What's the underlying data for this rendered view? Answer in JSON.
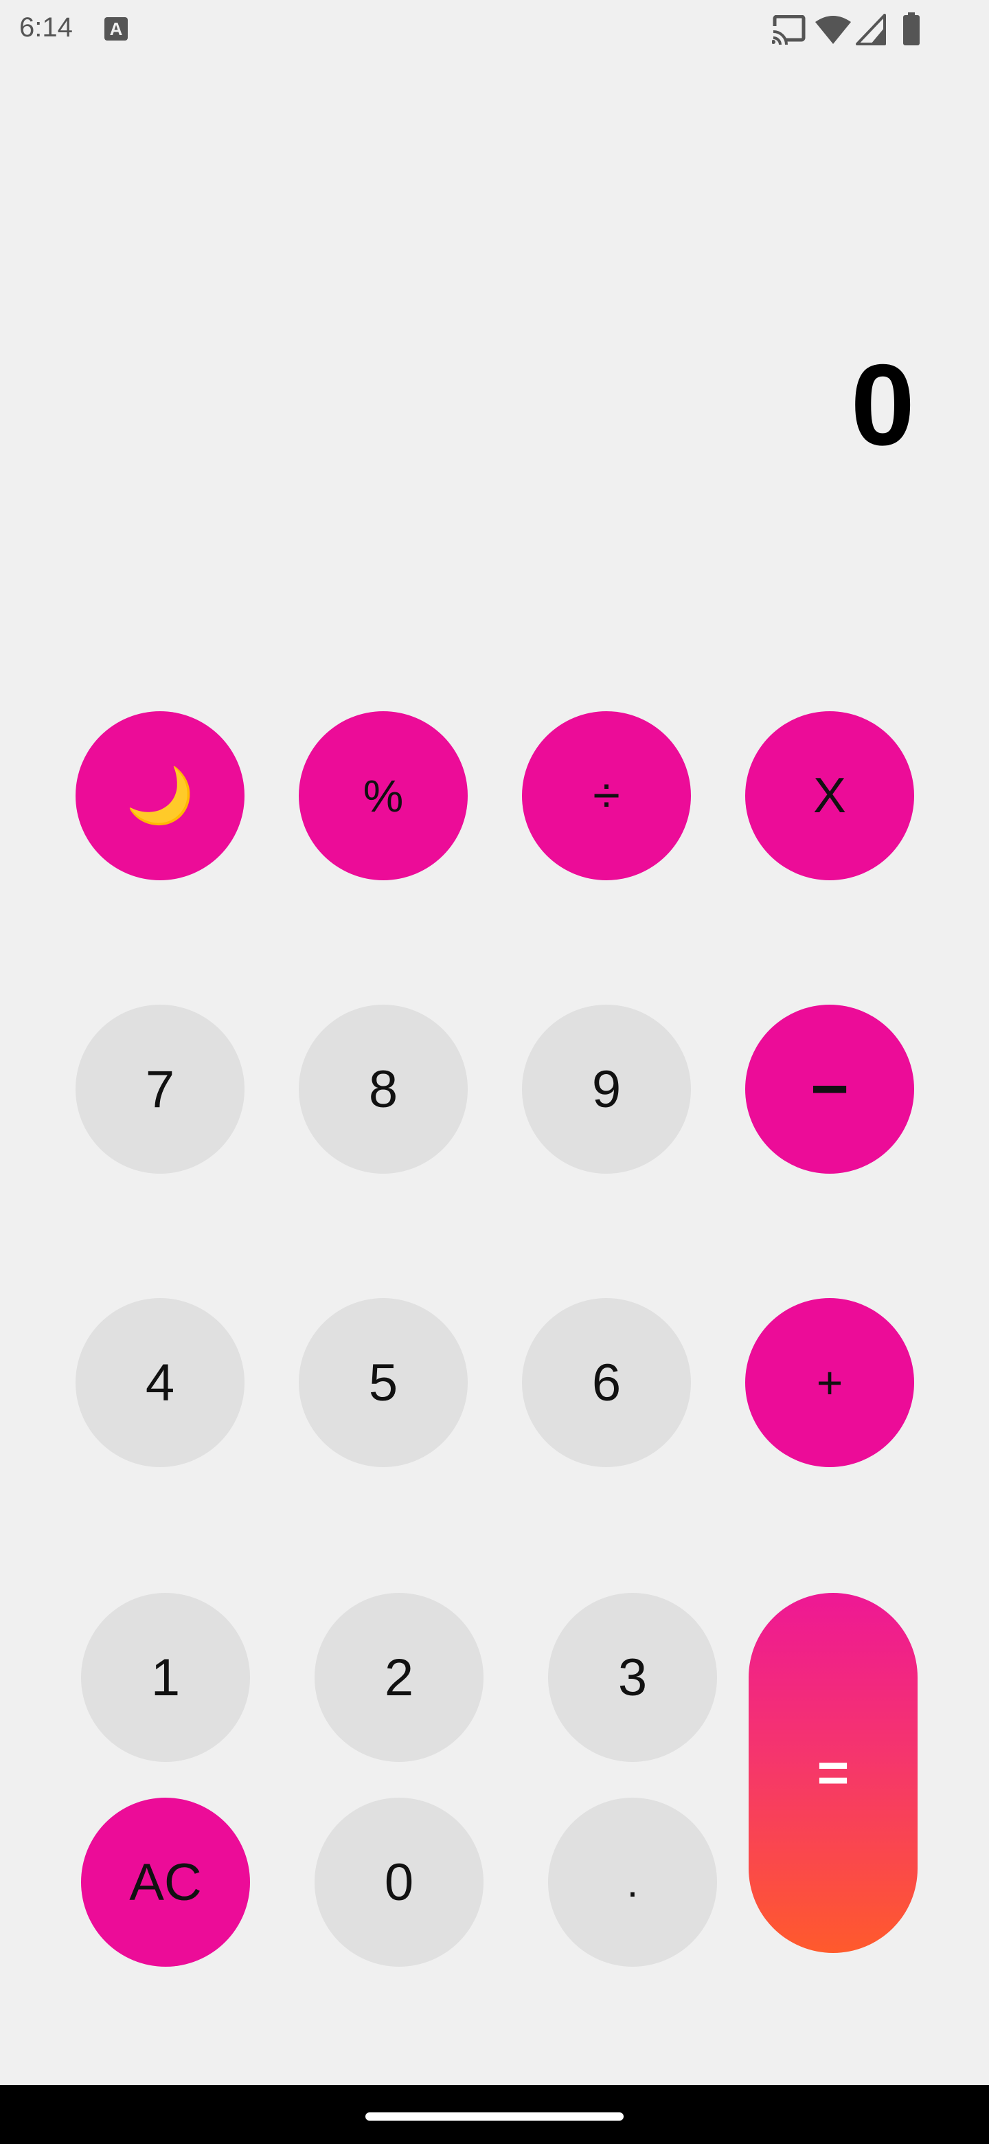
{
  "status_bar": {
    "time": "6:14",
    "notification_icon_letter": "A",
    "icons": [
      "cast-icon",
      "wifi-icon",
      "signal-icon",
      "battery-icon"
    ]
  },
  "display": {
    "value": "0"
  },
  "buttons": {
    "theme_toggle": "🌙",
    "percent": "%",
    "divide": "÷",
    "multiply": "X",
    "seven": "7",
    "eight": "8",
    "nine": "9",
    "minus": "−",
    "four": "4",
    "five": "5",
    "six": "6",
    "plus": "+",
    "one": "1",
    "two": "2",
    "three": "3",
    "equals": "=",
    "clear": "AC",
    "zero": "0",
    "decimal": "."
  },
  "colors": {
    "operator": "#ec0c98",
    "digit": "#e0e0e0",
    "background": "#f0f0f0",
    "equals_gradient_top": "#ee1895",
    "equals_gradient_bottom": "#ff5a2c"
  }
}
